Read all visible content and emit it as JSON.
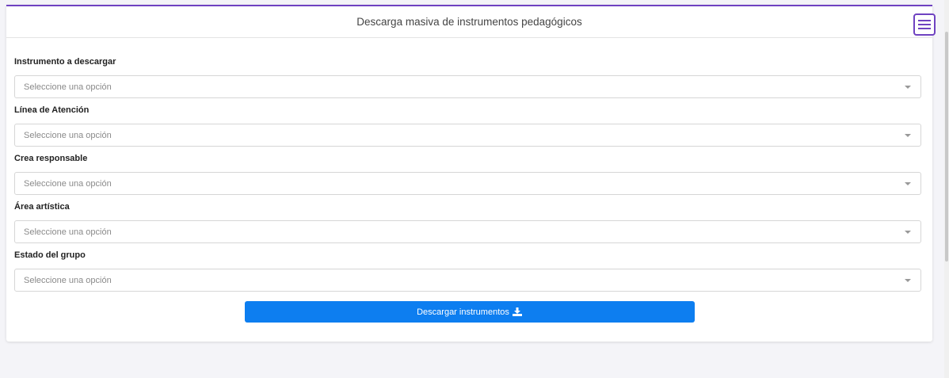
{
  "header": {
    "title": "Descarga masiva de instrumentos pedagógicos",
    "menu_icon": "hamburger-menu-icon",
    "accent": "#6f42c1"
  },
  "form": {
    "fields": [
      {
        "label": "Instrumento a descargar",
        "placeholder": "Seleccione una opción"
      },
      {
        "label": "Línea de Atención",
        "placeholder": "Seleccione una opción"
      },
      {
        "label": "Crea responsable",
        "placeholder": "Seleccione una opción"
      },
      {
        "label": "Área artística",
        "placeholder": "Seleccione una opción"
      },
      {
        "label": "Estado del grupo",
        "placeholder": "Seleccione una opción"
      }
    ],
    "submit": {
      "label": "Descargar instrumentos",
      "icon": "download-icon",
      "color": "#0d7ef0"
    }
  }
}
